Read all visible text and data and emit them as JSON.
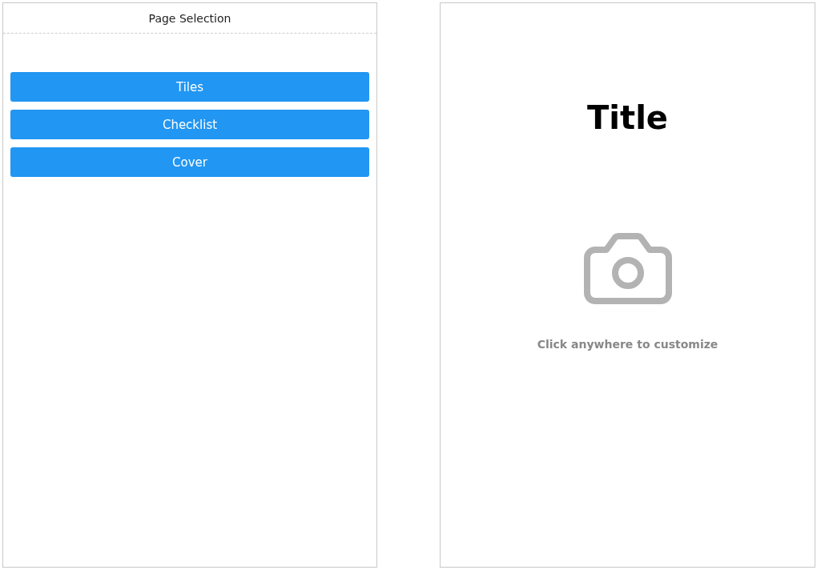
{
  "page_selection": {
    "title": "Page Selection",
    "buttons": [
      {
        "label": "Tiles"
      },
      {
        "label": "Checklist"
      },
      {
        "label": "Cover"
      }
    ]
  },
  "preview": {
    "title": "Title",
    "hint": "Click anywhere to customize"
  }
}
